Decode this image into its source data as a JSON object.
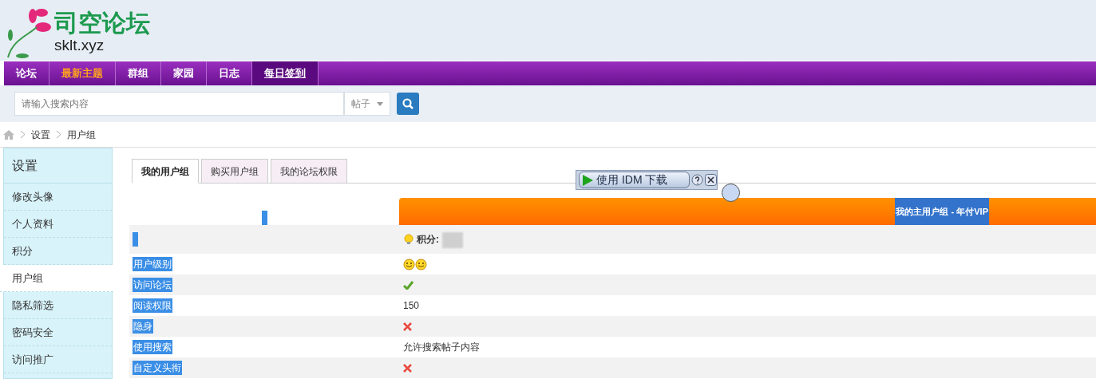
{
  "logo": {
    "title": "司空论坛",
    "domain": "sklt.xyz"
  },
  "nav": [
    {
      "label": "论坛",
      "highlighted": false,
      "selected": false
    },
    {
      "label": "最新主题",
      "highlighted": true,
      "selected": false
    },
    {
      "label": "群组",
      "highlighted": false,
      "selected": false
    },
    {
      "label": "家园",
      "highlighted": false,
      "selected": false
    },
    {
      "label": "日志",
      "highlighted": false,
      "selected": false
    },
    {
      "label": "每日签到",
      "highlighted": false,
      "selected": true
    }
  ],
  "search": {
    "placeholder": "请输入搜索内容",
    "scope": "帖子"
  },
  "breadcrumb": [
    "设置",
    "用户组"
  ],
  "sidebar": {
    "title": "设置",
    "items": [
      {
        "label": "修改头像",
        "selected": false
      },
      {
        "label": "个人资料",
        "selected": false
      },
      {
        "label": "积分",
        "selected": false
      },
      {
        "label": "用户组",
        "selected": true
      },
      {
        "label": "隐私筛选",
        "selected": false
      },
      {
        "label": "密码安全",
        "selected": false
      },
      {
        "label": "访问推广",
        "selected": false
      }
    ]
  },
  "tabs": [
    {
      "label": "我的用户组",
      "selected": true
    },
    {
      "label": "购买用户组",
      "selected": false
    },
    {
      "label": "我的论坛权限",
      "selected": false
    }
  ],
  "idm_bar": {
    "label": "使用 IDM 下载"
  },
  "group_header": "我的主用户组 - 年付VIP",
  "points_label": "积分:",
  "rows": [
    {
      "label": "用户级别",
      "kind": "smileys"
    },
    {
      "label": "访问论坛",
      "kind": "check"
    },
    {
      "label": "阅读权限",
      "kind": "text",
      "value": "150"
    },
    {
      "label": "隐身",
      "kind": "cross"
    },
    {
      "label": "使用搜索",
      "kind": "text",
      "value": "允许搜索帖子内容"
    },
    {
      "label": "自定义头衔",
      "kind": "cross"
    }
  ]
}
